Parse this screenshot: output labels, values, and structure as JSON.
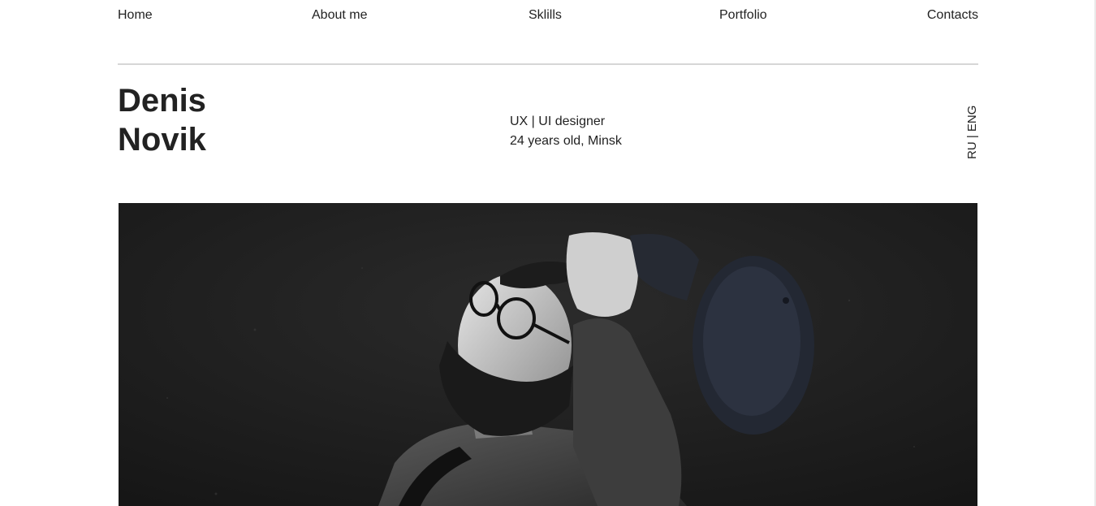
{
  "nav": {
    "home": "Home",
    "about": "About me",
    "skills": "Sklills",
    "portfolio": "Portfolio",
    "contacts": "Contacts"
  },
  "hero": {
    "first_name": "Denis",
    "last_name": "Novik",
    "role": "UX | UI designer",
    "age_location": "24 years old, Minsk"
  },
  "language": {
    "ru": "RU",
    "separator": " | ",
    "eng": "ENG"
  },
  "photo": {
    "subject": "portrait-photo"
  },
  "colors": {
    "text": "#222222",
    "divider": "#d6d6d6",
    "photo_background": "#1e1e1e"
  }
}
